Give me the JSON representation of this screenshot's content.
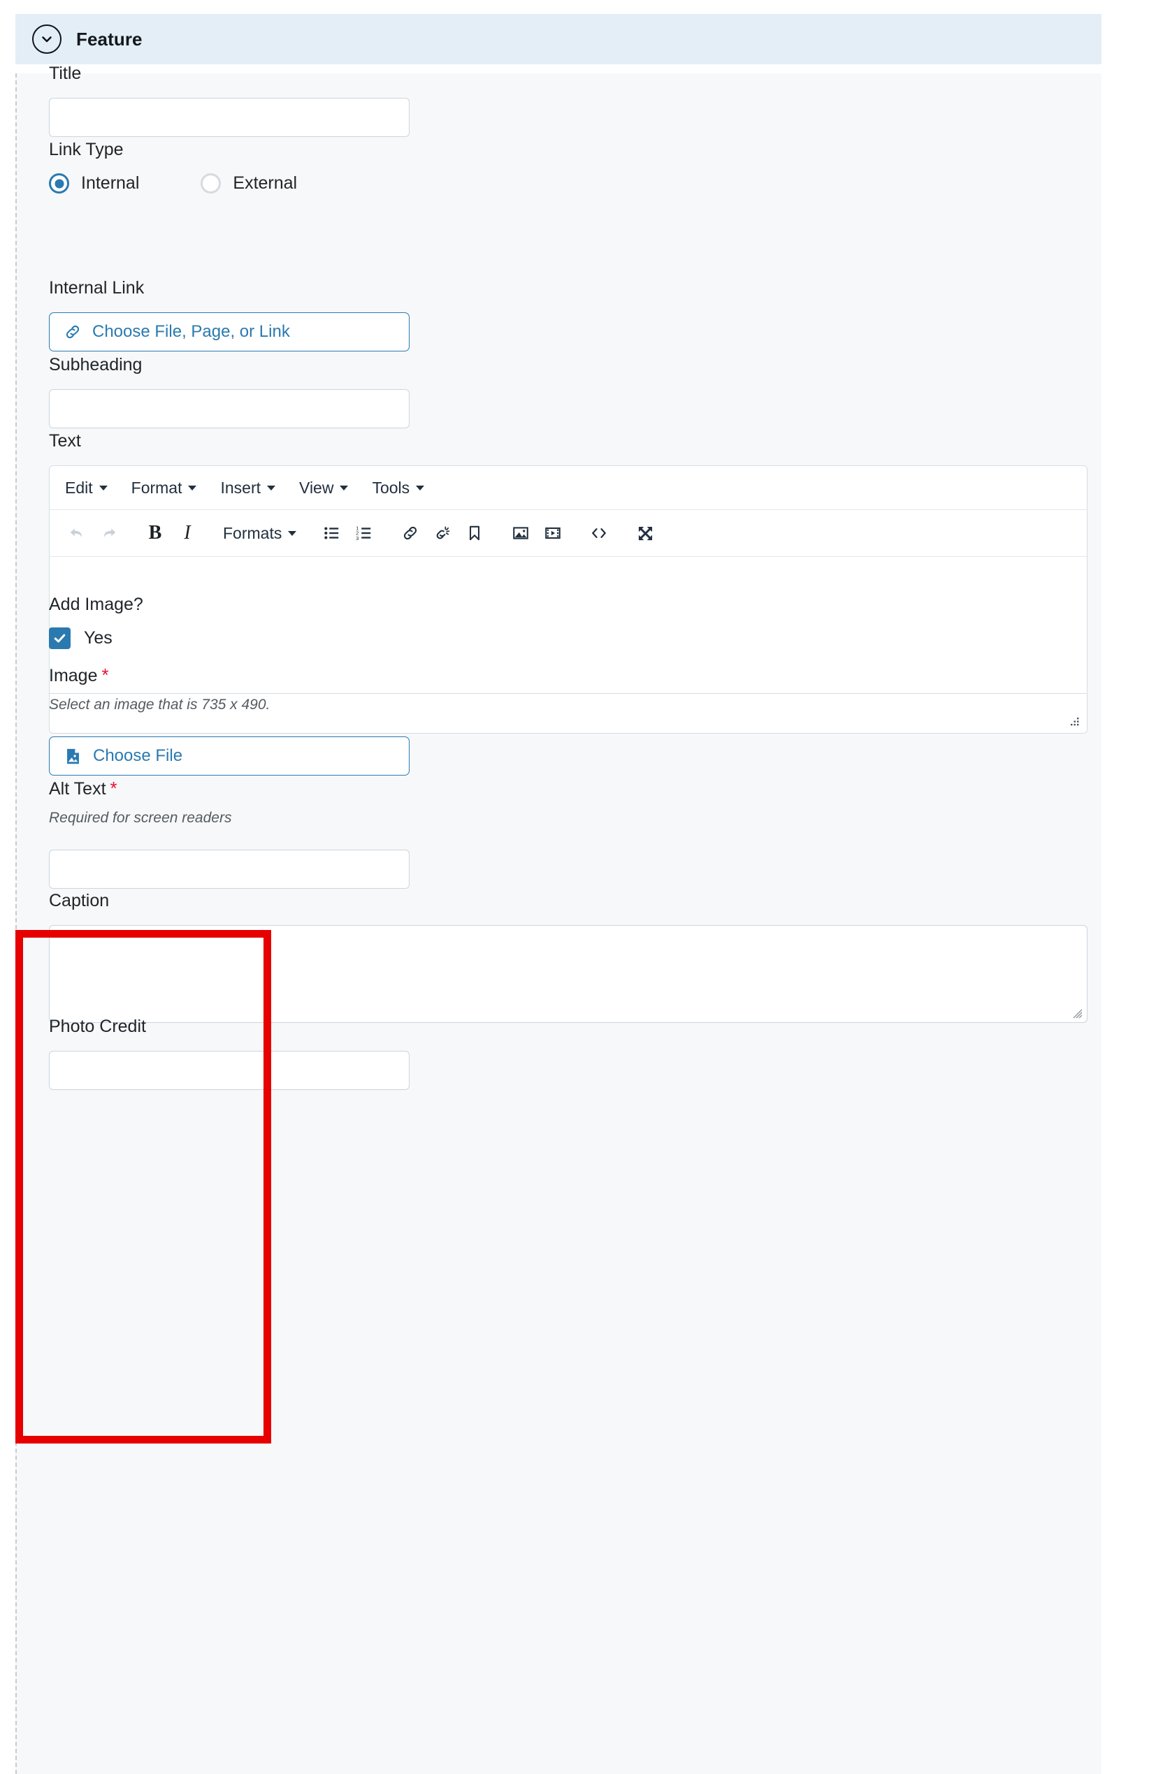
{
  "accordion": {
    "title": "Feature",
    "toggle_icon": "chevron-down-icon"
  },
  "fields": {
    "title": {
      "label": "Title",
      "value": ""
    },
    "link_type": {
      "label": "Link Type",
      "options": [
        {
          "label": "Internal",
          "selected": true
        },
        {
          "label": "External",
          "selected": false
        }
      ]
    },
    "internal_link": {
      "label": "Internal Link",
      "button_label": "Choose File, Page, or Link",
      "button_icon": "link-icon"
    },
    "subheading": {
      "label": "Subheading",
      "value": ""
    },
    "text": {
      "label": "Text"
    },
    "add_image": {
      "label": "Add Image?",
      "checkbox_label": "Yes",
      "checked": true
    },
    "image": {
      "label": "Image",
      "required": true,
      "required_marker": "*",
      "helper": "Select an image that is 735 x 490.",
      "button_label": "Choose File",
      "button_icon": "image-file-icon"
    },
    "alt_text": {
      "label": "Alt Text",
      "required": true,
      "required_marker": "*",
      "helper": "Required for screen readers",
      "value": ""
    },
    "caption": {
      "label": "Caption",
      "value": ""
    },
    "photo_credit": {
      "label": "Photo Credit",
      "value": ""
    }
  },
  "editor": {
    "menus": [
      {
        "label": "Edit"
      },
      {
        "label": "Format"
      },
      {
        "label": "Insert"
      },
      {
        "label": "View"
      },
      {
        "label": "Tools"
      }
    ],
    "formats_label": "Formats",
    "toolbar_icons": [
      "undo-icon",
      "redo-icon",
      "bold-icon",
      "italic-icon",
      "formats-dropdown",
      "bullet-list-icon",
      "numbered-list-icon",
      "link-icon",
      "unlink-icon",
      "anchor-icon",
      "image-icon",
      "media-icon",
      "source-code-icon",
      "fullscreen-icon"
    ],
    "content": ""
  },
  "colors": {
    "accent": "#2a7ab0",
    "header_bg": "#e3eef7",
    "body_bg": "#f6f8fa",
    "required": "#e8112d",
    "highlight": "#e60000",
    "border": "#ccd5dd"
  }
}
